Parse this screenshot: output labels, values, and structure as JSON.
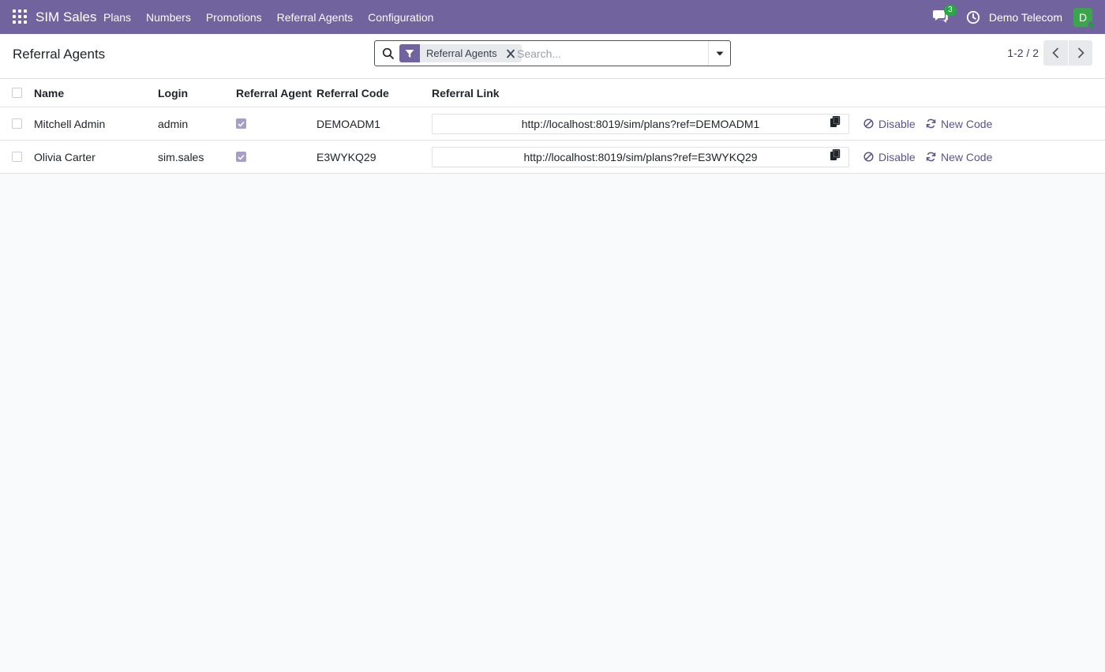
{
  "navbar": {
    "brand": "SIM Sales",
    "menu": [
      "Plans",
      "Numbers",
      "Promotions",
      "Referral Agents",
      "Configuration"
    ],
    "message_count": "3",
    "company": "Demo Telecom",
    "avatar_initial": "D",
    "accent_color": "#71639e"
  },
  "control": {
    "title": "Referral Agents",
    "facet_label": "Referral Agents",
    "search_placeholder": "Search...",
    "pager": "1-2 / 2"
  },
  "table": {
    "headers": {
      "name": "Name",
      "login": "Login",
      "agent": "Referral Agent",
      "code": "Referral Code",
      "link": "Referral Link"
    },
    "rows": [
      {
        "name": "Mitchell Admin",
        "login": "admin",
        "is_agent": true,
        "code": "DEMOADM1",
        "link": "http://localhost:8019/sim/plans?ref=DEMOADM1",
        "disable_label": "Disable",
        "new_code_label": "New Code"
      },
      {
        "name": "Olivia Carter",
        "login": "sim.sales",
        "is_agent": true,
        "code": "E3WYKQ29",
        "link": "http://localhost:8019/sim/plans?ref=E3WYKQ29",
        "disable_label": "Disable",
        "new_code_label": "New Code"
      }
    ]
  },
  "icons": {
    "apps": "apps-grid-icon",
    "chat": "chat-icon",
    "activity": "clock-icon",
    "search": "search-icon",
    "filter": "filter-icon",
    "remove": "close-icon",
    "dropdown": "caret-down-icon",
    "prev": "chevron-left-icon",
    "next": "chevron-right-icon",
    "copy": "copy-icon",
    "disable": "ban-icon",
    "refresh": "refresh-icon"
  }
}
